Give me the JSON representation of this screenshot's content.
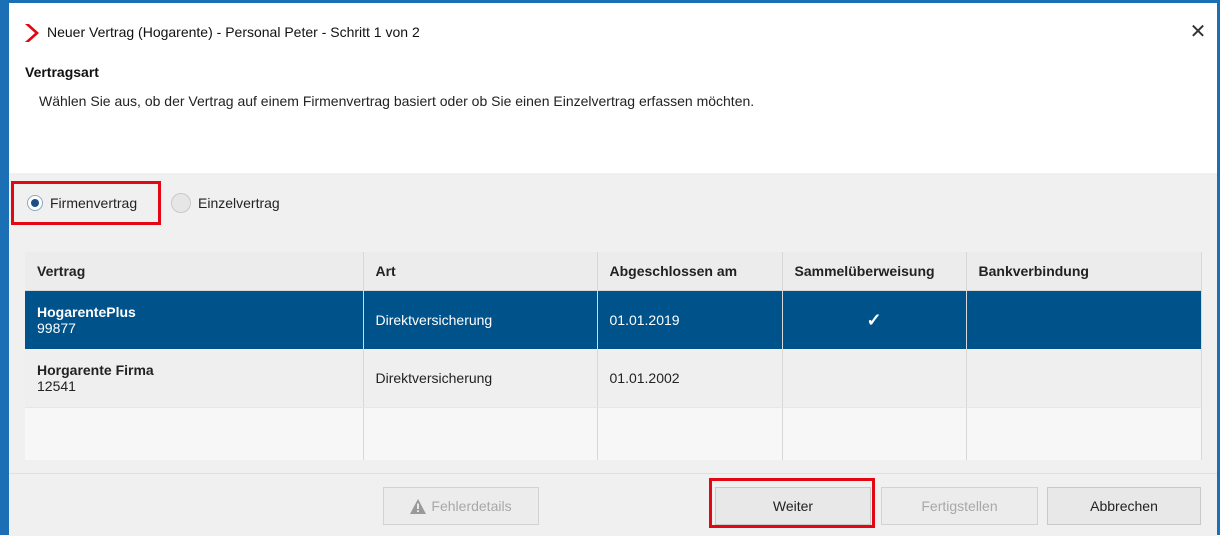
{
  "window": {
    "title": "Neuer Vertrag (Hogarente) - Personal Peter - Schritt 1 von 2",
    "close_icon": "close-icon",
    "brand_color": "#e30613"
  },
  "section": {
    "title": "Vertragsart",
    "description": "Wählen Sie aus, ob der Vertrag auf einem Firmenvertrag basiert oder ob Sie einen Einzelvertrag erfassen möchten."
  },
  "options": {
    "firmenvertrag": {
      "label": "Firmenvertrag",
      "checked": true
    },
    "einzelvertrag": {
      "label": "Einzelvertrag",
      "checked": false
    }
  },
  "table": {
    "columns": [
      "Vertrag",
      "Art",
      "Abgeschlossen am",
      "Sammelüberweisung",
      "Bankverbindung"
    ],
    "rows": [
      {
        "name": "HogarentePlus",
        "number": "99877",
        "art": "Direktversicherung",
        "date": "01.01.2019",
        "sammel": "✓",
        "bank": "",
        "selected": true
      },
      {
        "name": "Horgarente Firma",
        "number": "12541",
        "art": "Direktversicherung",
        "date": "01.01.2002",
        "sammel": "",
        "bank": "",
        "selected": false
      }
    ],
    "selected_color": "#00528a"
  },
  "footer": {
    "fehlerdetails": "Fehlerdetails",
    "weiter": "Weiter",
    "fertigstellen": "Fertigstellen",
    "abbrechen": "Abbrechen"
  },
  "highlight_color": "#e30613"
}
